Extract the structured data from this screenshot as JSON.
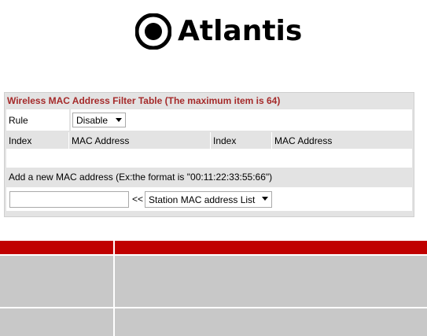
{
  "logo": {
    "brand": "Atlantis"
  },
  "filter_table": {
    "title": "Wireless MAC Address Filter Table (The maximum item is 64)",
    "rule_label": "Rule",
    "rule_value": "Disable",
    "columns": [
      "Index",
      "MAC Address",
      "Index",
      "MAC Address"
    ],
    "add_label": "Add a new MAC address (Ex:the format is \"00:11:22:33:55:66\")",
    "mac_input_value": "",
    "arrow_label": "<<",
    "station_select_value": "Station MAC address List"
  },
  "colors": {
    "title": "#a52a2a",
    "header_bar": "#c00000",
    "panel_bg": "#e3e3e3",
    "desc_cell_bg": "#c8c8c8"
  }
}
